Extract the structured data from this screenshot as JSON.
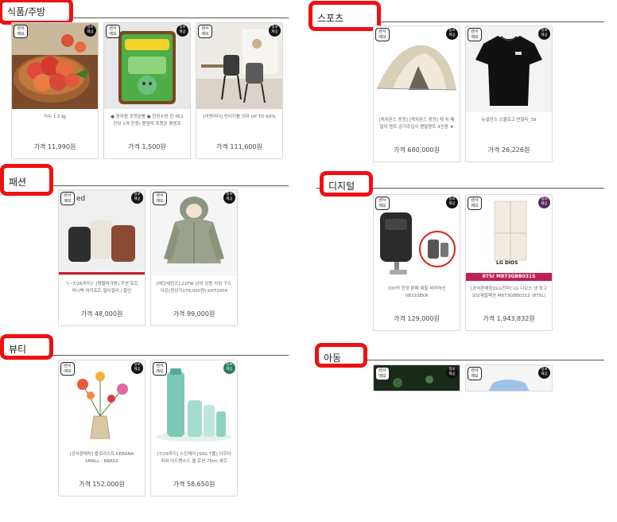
{
  "badges": {
    "left": "렌서\n예보",
    "right": "정보\n제공"
  },
  "sections": {
    "food": {
      "title": "식품/주방",
      "cards": [
        {
          "desc": "자두 1.5 ㎏",
          "price": "가격 11,990원"
        },
        {
          "desc": "● 동아원 포켓몬빵 ● 한정수량 한 세(1인당 1개 한정) 랜덤띠 포켓몬 팬용조",
          "price": "가격 1,500원"
        },
        {
          "desc": "[마켓리더] 빈티지풍 의자 UP TO 60%",
          "price": "가격 111,600원"
        }
      ]
    },
    "sports": {
      "title": "스포츠",
      "cards": [
        {
          "desc": "[캐치몬드 증정] [캐치몬드 증정] 캐 치 패밀리 텐트 공기주입식 렌탈텐트 4인용 ★",
          "price": "가격 680,000원"
        },
        {
          "desc": "뉴발란스 스몰로고 반팔티_39",
          "price": "가격 26,226원"
        }
      ]
    },
    "fashion": {
      "title": "패션",
      "cards": [
        {
          "desc": "\"(~7/26까지)\" [텀블러가방] 쿠션 토트 미니백 라지토트 멀티컬러 / 할인",
          "price": "가격 48,000원"
        },
        {
          "desc": "[에잇세컨즈] 21FW 남여 공용 라임 구스 다운(정상가279,000원) KHT2004",
          "price": "가격 99,000원"
        }
      ]
    },
    "digital": {
      "title": "디지털",
      "cards": [
        {
          "desc": "100억 한정 판매 테팔 비어머신 VB310EKR",
          "price": "가격 129,000원",
          "promo": "875ℓ  M873GBB031S"
        },
        {
          "desc": "[공식판매점][LG전자] LG 디오스 냉 장고 오브제컬렉션 M873GBB031S (875L)",
          "price": "가격 1,943,832원",
          "logo": "LG DIOS"
        }
      ]
    },
    "beauty": {
      "title": "뷰티",
      "cards": [
        {
          "desc": "[공식판매처] 플로리스트 KEBANA SMALL - BRASS",
          "price": "가격 152,000원"
        },
        {
          "desc": "[7/29까지] 스킨케어 [SSG T몰] 아쿠아 파워 어드밴스드 젤 로션 75ml 세트",
          "price": "가격 58,650원"
        }
      ]
    },
    "kids": {
      "title": "아동"
    }
  }
}
